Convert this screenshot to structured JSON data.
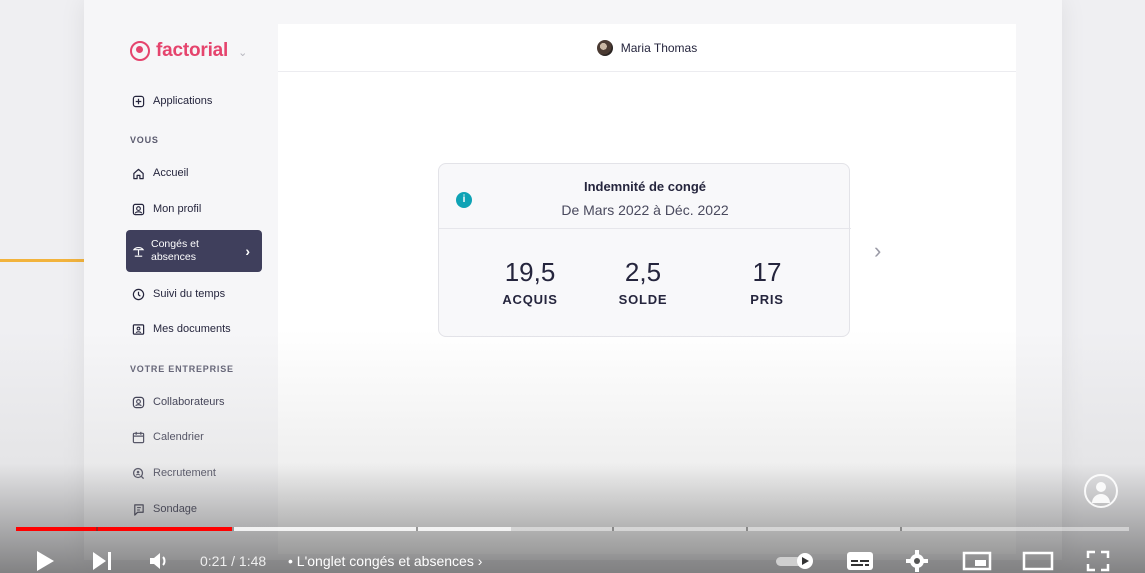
{
  "brand": {
    "name": "factorial"
  },
  "sidebar": {
    "applications_label": "Applications",
    "section_vous": "VOUS",
    "items_vous": [
      {
        "label": "Accueil",
        "icon": "home-icon"
      },
      {
        "label": "Mon profil",
        "icon": "profile-icon"
      },
      {
        "label": "Congés et absences",
        "icon": "beach-icon",
        "active": true
      },
      {
        "label": "Suivi du temps",
        "icon": "clock-icon"
      },
      {
        "label": "Mes documents",
        "icon": "document-icon"
      }
    ],
    "section_entreprise": "VOTRE ENTREPRISE",
    "items_entreprise": [
      {
        "label": "Collaborateurs",
        "icon": "people-icon"
      },
      {
        "label": "Calendrier",
        "icon": "calendar-icon"
      },
      {
        "label": "Recrutement",
        "icon": "search-person-icon"
      },
      {
        "label": "Sondage",
        "icon": "survey-icon"
      }
    ]
  },
  "topbar": {
    "user_name": "Maria Thomas"
  },
  "card": {
    "title": "Indemnité de congé",
    "subtitle": "De Mars 2022 à Déc. 2022",
    "stats": [
      {
        "value": "19,5",
        "label": "ACQUIS"
      },
      {
        "value": "2,5",
        "label": "SOLDE"
      },
      {
        "value": "17",
        "label": "PRIS"
      }
    ]
  },
  "player": {
    "time": "0:21 / 1:48",
    "chapter": "• L'onglet congés et absences",
    "progress_played": 0.194,
    "colors": {
      "played": "#ff0000",
      "accent": "#e5446d",
      "teal": "#0fa3b5"
    }
  }
}
